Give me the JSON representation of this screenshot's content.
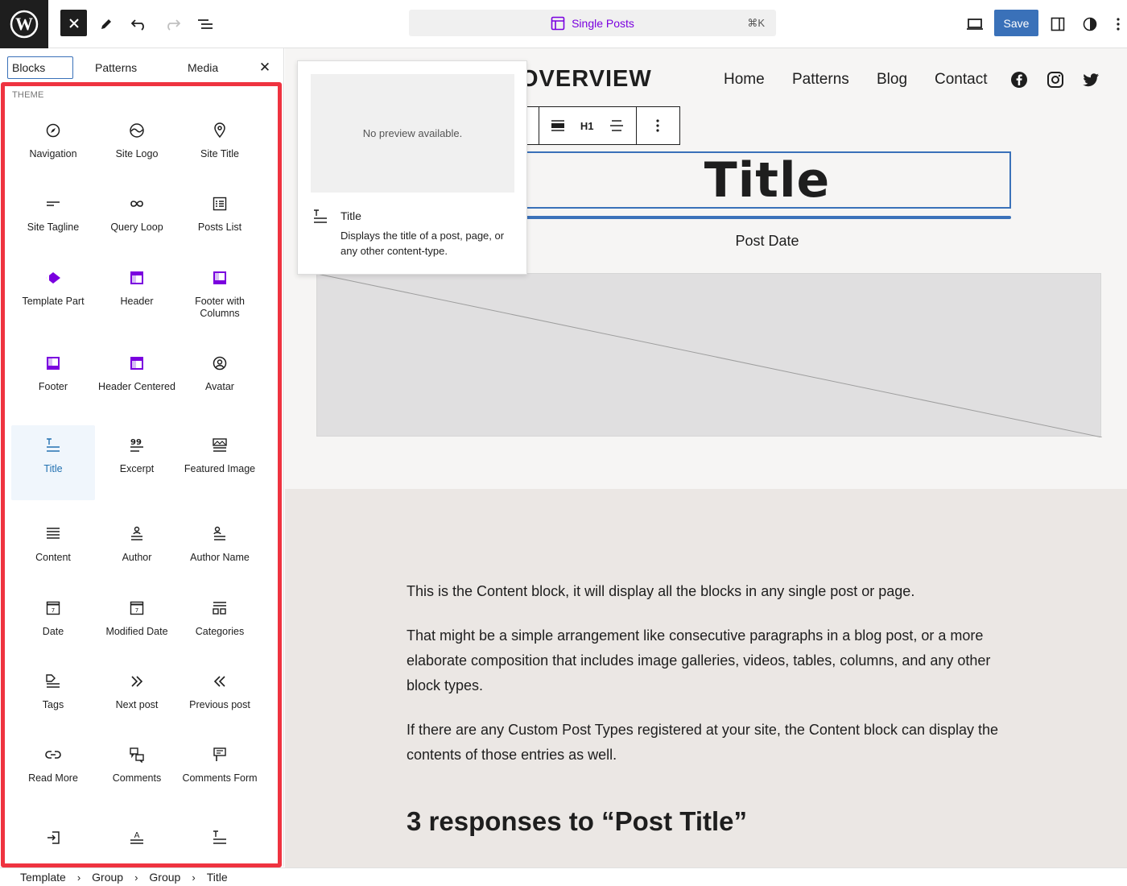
{
  "topbar": {
    "document_title": "Single Posts",
    "shortcut": "⌘K",
    "save_label": "Save",
    "accent": "#3a71b9",
    "template_color": "#7a00df"
  },
  "sidebar": {
    "tabs": [
      {
        "label": "Blocks"
      },
      {
        "label": "Patterns"
      },
      {
        "label": "Media"
      }
    ],
    "close_label": "✕",
    "section_label": "THEME",
    "blocks": [
      {
        "label": "Navigation",
        "icon": "compass-icon"
      },
      {
        "label": "Site Logo",
        "icon": "site-logo-icon"
      },
      {
        "label": "Site Title",
        "icon": "map-pin-icon"
      },
      {
        "label": "Site Tagline",
        "icon": "tagline-icon"
      },
      {
        "label": "Query Loop",
        "icon": "loop-icon"
      },
      {
        "label": "Posts List",
        "icon": "posts-list-icon"
      },
      {
        "label": "Template Part",
        "icon": "template-part-icon"
      },
      {
        "label": "Header",
        "icon": "header-icon"
      },
      {
        "label": "Footer with Columns",
        "icon": "footer-icon"
      },
      {
        "label": "Footer",
        "icon": "footer-icon"
      },
      {
        "label": "Header Centered",
        "icon": "header-icon"
      },
      {
        "label": "Avatar",
        "icon": "avatar-icon"
      },
      {
        "label": "Title",
        "icon": "title-icon"
      },
      {
        "label": "Excerpt",
        "icon": "excerpt-icon"
      },
      {
        "label": "Featured Image",
        "icon": "featured-image-icon"
      },
      {
        "label": "Content",
        "icon": "content-icon"
      },
      {
        "label": "Author",
        "icon": "author-icon"
      },
      {
        "label": "Author Name",
        "icon": "author-name-icon"
      },
      {
        "label": "Date",
        "icon": "calendar-icon"
      },
      {
        "label": "Modified Date",
        "icon": "calendar-icon"
      },
      {
        "label": "Categories",
        "icon": "categories-icon"
      },
      {
        "label": "Tags",
        "icon": "tag-icon"
      },
      {
        "label": "Next post",
        "icon": "chevrons-right-icon"
      },
      {
        "label": "Previous post",
        "icon": "chevrons-left-icon"
      },
      {
        "label": "Read More",
        "icon": "link-icon"
      },
      {
        "label": "Comments",
        "icon": "comments-icon"
      },
      {
        "label": "Comments Form",
        "icon": "comments-form-icon"
      },
      {
        "label": "",
        "icon": "login-icon"
      },
      {
        "label": "",
        "icon": "post-author-icon"
      },
      {
        "label": "",
        "icon": "title-icon"
      }
    ],
    "highlight_color": "#ef3340"
  },
  "canvas": {
    "site_title_visible": "OVERVIEW",
    "nav": [
      "Home",
      "Patterns",
      "Blog",
      "Contact"
    ],
    "social": [
      "facebook-icon",
      "instagram-icon",
      "twitter-icon"
    ],
    "toolbar_heading_level": "H1",
    "title": "Title",
    "post_date": "Post Date",
    "content_paragraphs": [
      "This is the Content block, it will display all the blocks in any single post or page.",
      "That might be a simple arrangement like consecutive paragraphs in a blog post, or a more elaborate composition that includes image galleries, videos, tables, columns, and any other block types.",
      "If there are any Custom Post Types registered at your site, the Content block can display the contents of those entries as well."
    ],
    "responses_heading": "3 responses to “Post Title”"
  },
  "preview": {
    "no_preview": "No preview available.",
    "name": "Title",
    "description": "Displays the title of a post, page, or any other content-type."
  },
  "breadcrumb": [
    "Template",
    "Group",
    "Group",
    "Title"
  ],
  "breadcrumb_separator": "›"
}
